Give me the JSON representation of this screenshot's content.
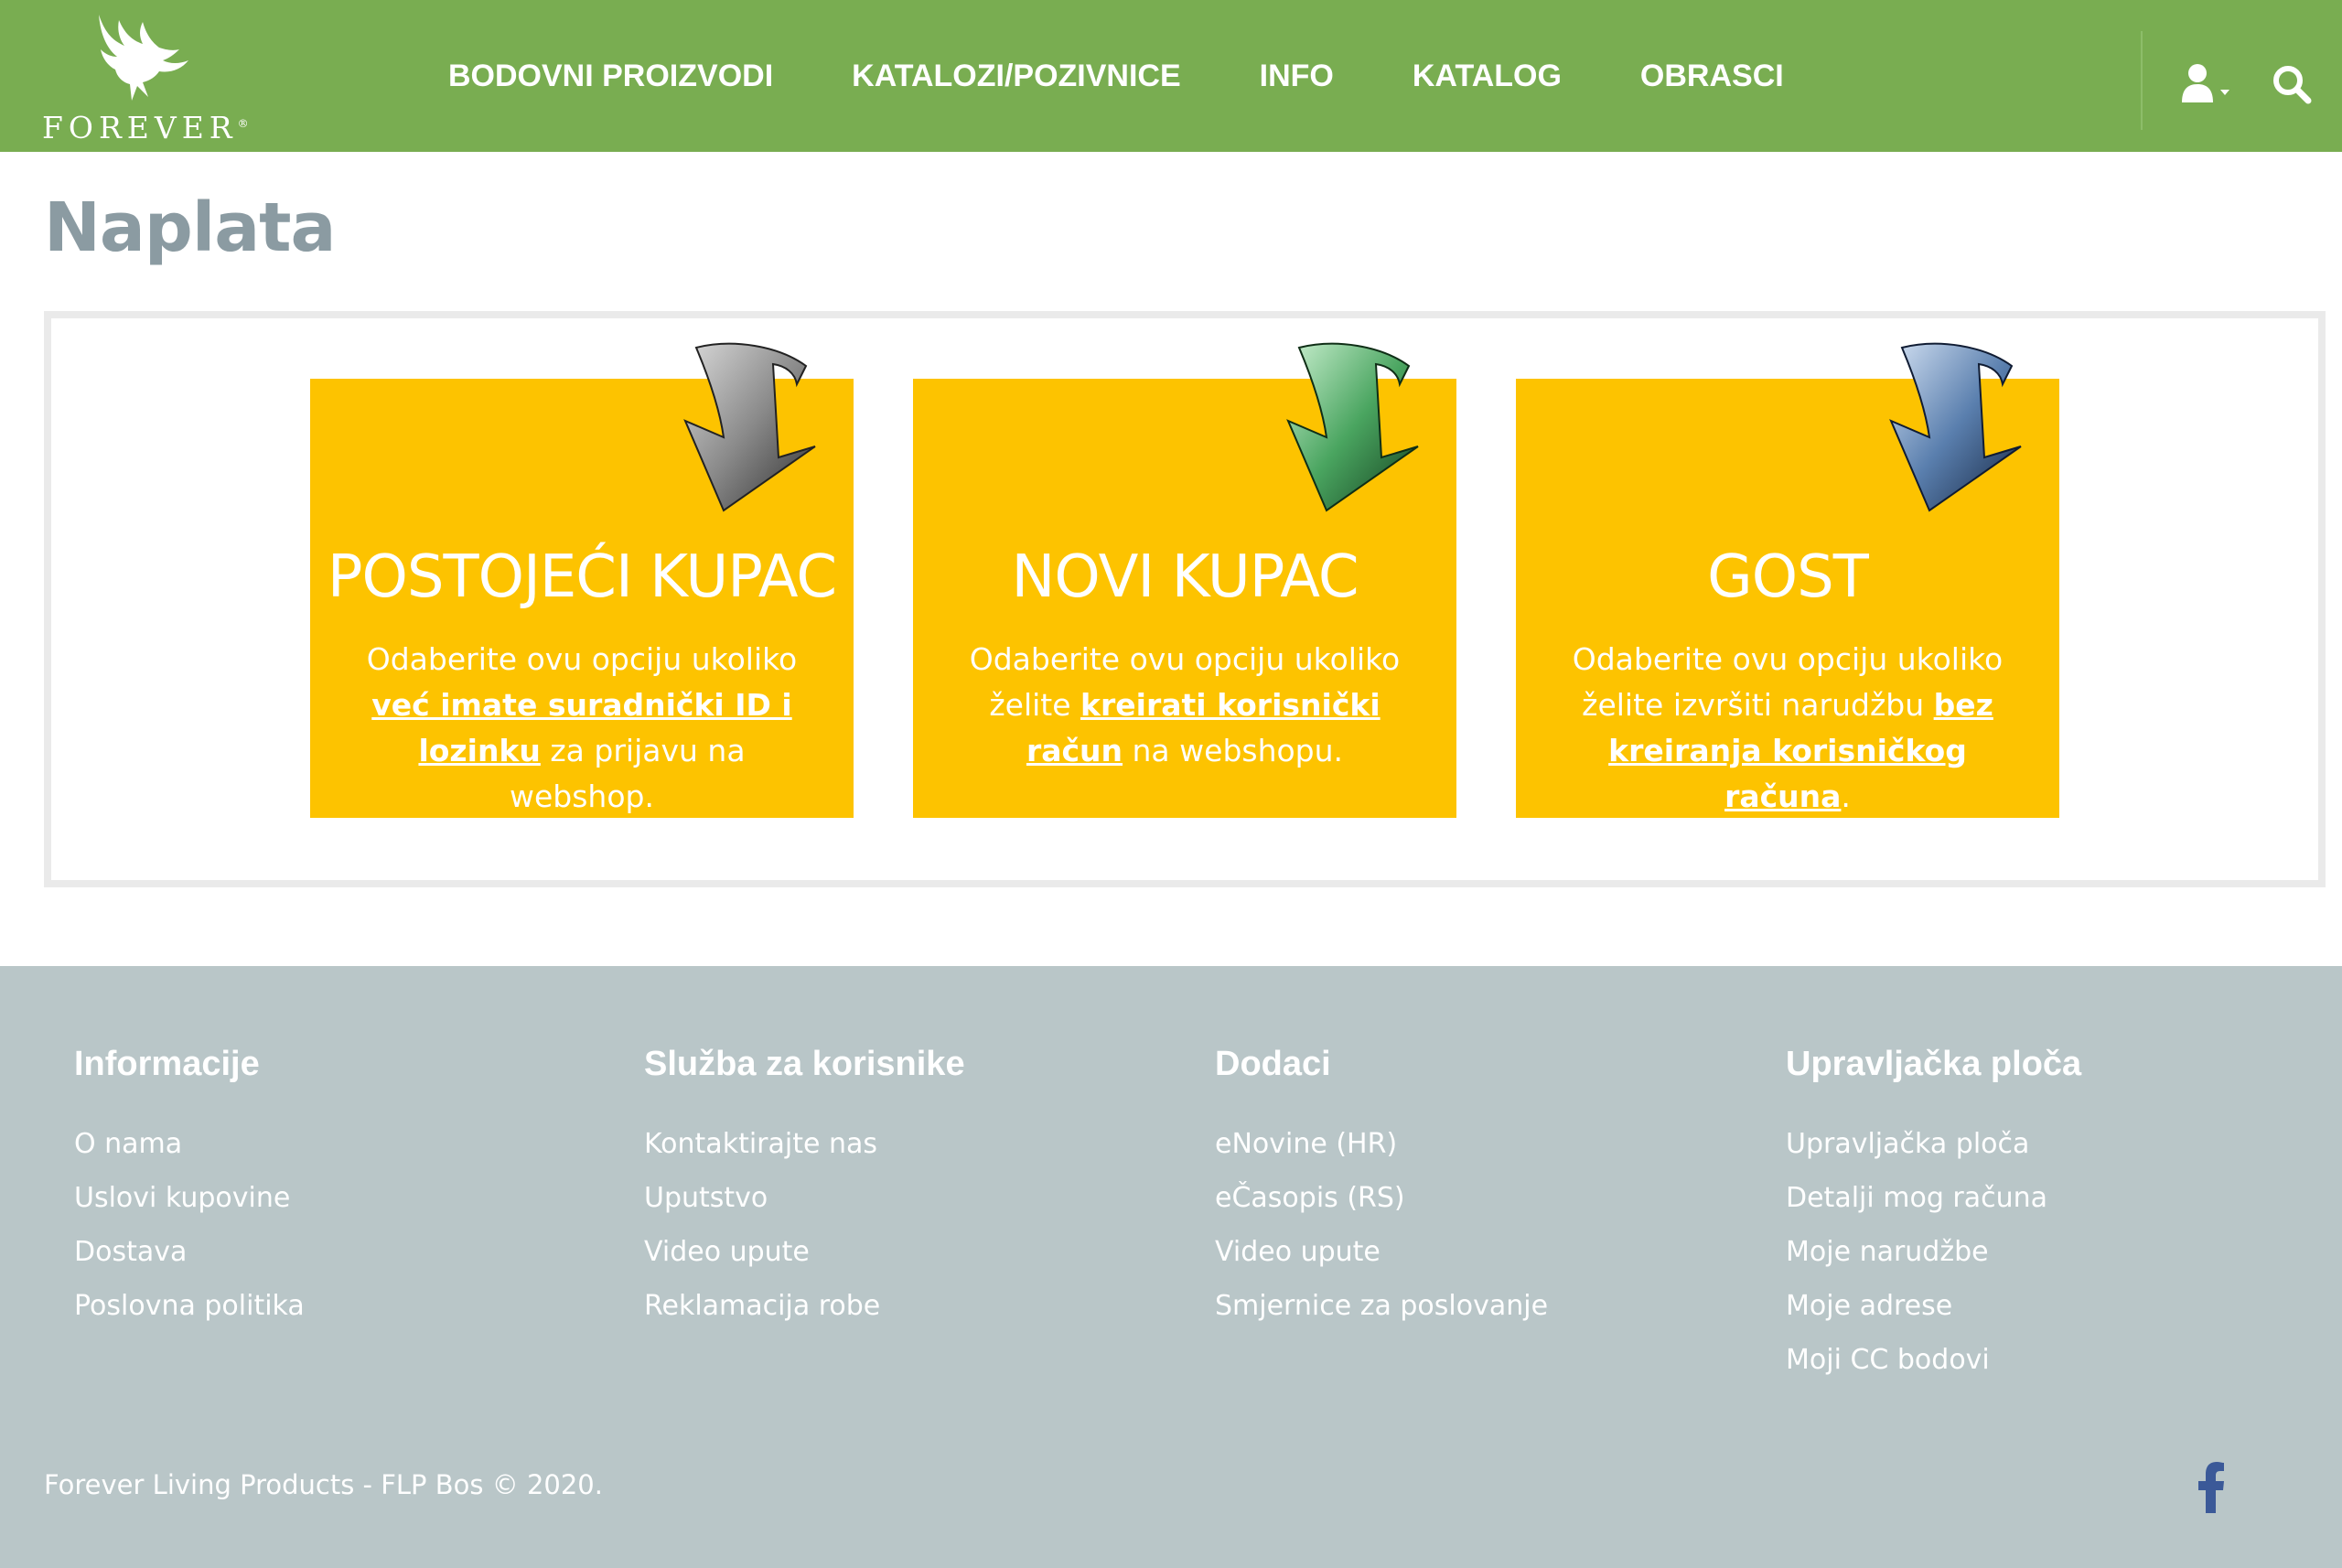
{
  "brand": {
    "logo_text": "FOREVER",
    "logo_mark": "®"
  },
  "nav": {
    "items": [
      {
        "label": "BODOVNI PROIZVODI"
      },
      {
        "label": "KATALOZI/POZIVNICE"
      },
      {
        "label": "INFO"
      },
      {
        "label": "KATALOG"
      },
      {
        "label": "OBRASCI"
      }
    ],
    "user_icon": "user-dropdown-icon",
    "search_icon": "search-icon"
  },
  "page": {
    "title": "Naplata"
  },
  "cards": [
    {
      "title": "POSTOJEĆI KUPAC",
      "arrow_color": "gray",
      "text_before": "Odaberite ovu opciju ukoliko ",
      "link": "već imate suradnički ID i lozinku",
      "text_after": " za prijavu na webshop."
    },
    {
      "title": "NOVI KUPAC",
      "arrow_color": "green",
      "text_before": "Odaberite ovu opciju ukoliko želite ",
      "link": "kreirati korisnički račun",
      "text_after": " na webshopu."
    },
    {
      "title": "GOST",
      "arrow_color": "blue",
      "text_before": "Odaberite ovu opciju ukoliko želite izvršiti narudžbu ",
      "link": "bez kreiranja korisničkog računa",
      "text_after": "."
    }
  ],
  "footer": {
    "columns": [
      {
        "heading": "Informacije",
        "links": [
          "O nama",
          "Uslovi kupovine",
          "Dostava",
          "Poslovna politika"
        ]
      },
      {
        "heading": "Služba za korisnike",
        "links": [
          "Kontaktirajte nas",
          "Uputstvo",
          "Video upute",
          "Reklamacija robe"
        ]
      },
      {
        "heading": "Dodaci",
        "links": [
          "eNovine (HR)",
          "eČasopis (RS)",
          "Video upute",
          "Smjernice za poslovanje"
        ]
      },
      {
        "heading": "Upravljačka ploča",
        "links": [
          "Upravljačka ploča",
          "Detalji mog računa",
          "Moje narudžbe",
          "Moje adrese",
          "Moji CC bodovi"
        ]
      }
    ],
    "copyright": "Forever Living Products - FLP Bos © 2020.",
    "social_icon": "facebook-icon"
  },
  "colors": {
    "header_bg": "#79ad51",
    "card_bg": "#fdc300",
    "footer_bg": "#b9c6c8",
    "title_color": "#8b9ba2",
    "facebook_blue": "#3b5998"
  }
}
